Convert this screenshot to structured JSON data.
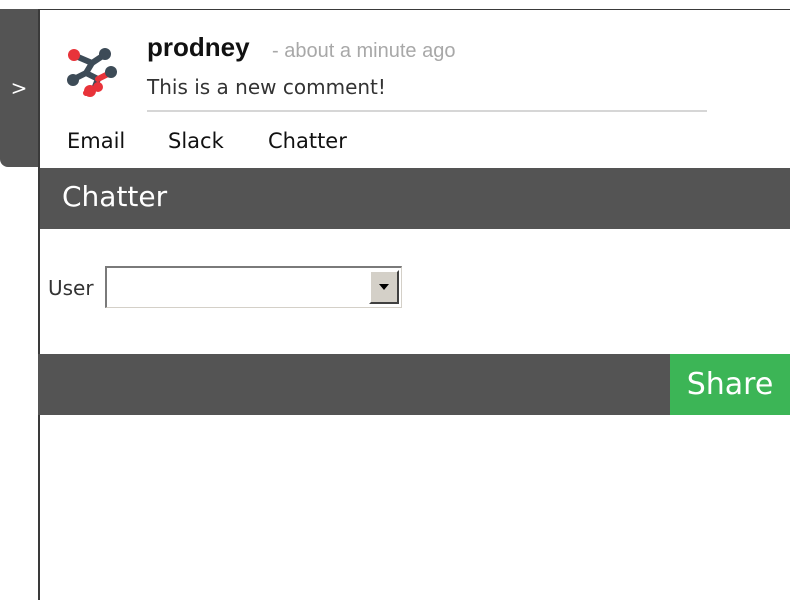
{
  "sidebar_toggle": {
    "label": ">"
  },
  "comment": {
    "author": "prodney",
    "timestamp": "- about a minute ago",
    "text": "This is a new comment!",
    "avatar_icon": "logo-molecule-icon",
    "colors": {
      "red": "#e8333a",
      "gray": "#3d4b57"
    }
  },
  "tabs": [
    {
      "label": "Email"
    },
    {
      "label": "Slack"
    },
    {
      "label": "Chatter"
    }
  ],
  "section": {
    "title": "Chatter"
  },
  "form": {
    "user_label": "User",
    "user_value": ""
  },
  "actions": {
    "share_label": "Share"
  },
  "colors": {
    "header_bg": "#545454",
    "share_bg": "#3cb556",
    "timestamp_text": "#a8a8a8"
  }
}
